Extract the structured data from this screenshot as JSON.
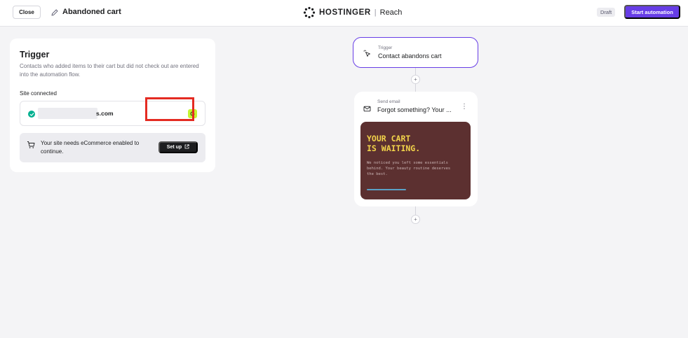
{
  "header": {
    "close_label": "Close",
    "title": "Abandoned cart",
    "brand_name": "HOSTINGER",
    "brand_separator": "|",
    "brand_product": "Reach",
    "status_badge": "Draft",
    "start_label": "Start automation"
  },
  "trigger_panel": {
    "title": "Trigger",
    "description": "Contacts who added items to their cart but did not check out are entered into the automation flow.",
    "site_label": "Site connected",
    "site_domain": "s.com",
    "ecommerce_notice": "Your site needs eCommerce enabled to continue.",
    "setup_label": "Set up"
  },
  "flow": {
    "trigger_node": {
      "label": "Trigger",
      "title": "Contact abandons cart"
    },
    "email_node": {
      "label": "Send email",
      "title": "Forgot something? Your ...",
      "preview_heading": "YOUR CART\nIS WAITING.",
      "preview_body": "We noticed you left some essentials behind. Your beauty routine deserves the best."
    },
    "add_step_symbol": "+"
  },
  "colors": {
    "accent": "#673de6",
    "highlight": "#e42b22",
    "success": "#00b090",
    "preview_bg": "#5c3030",
    "preview_heading": "#f2d34a"
  }
}
